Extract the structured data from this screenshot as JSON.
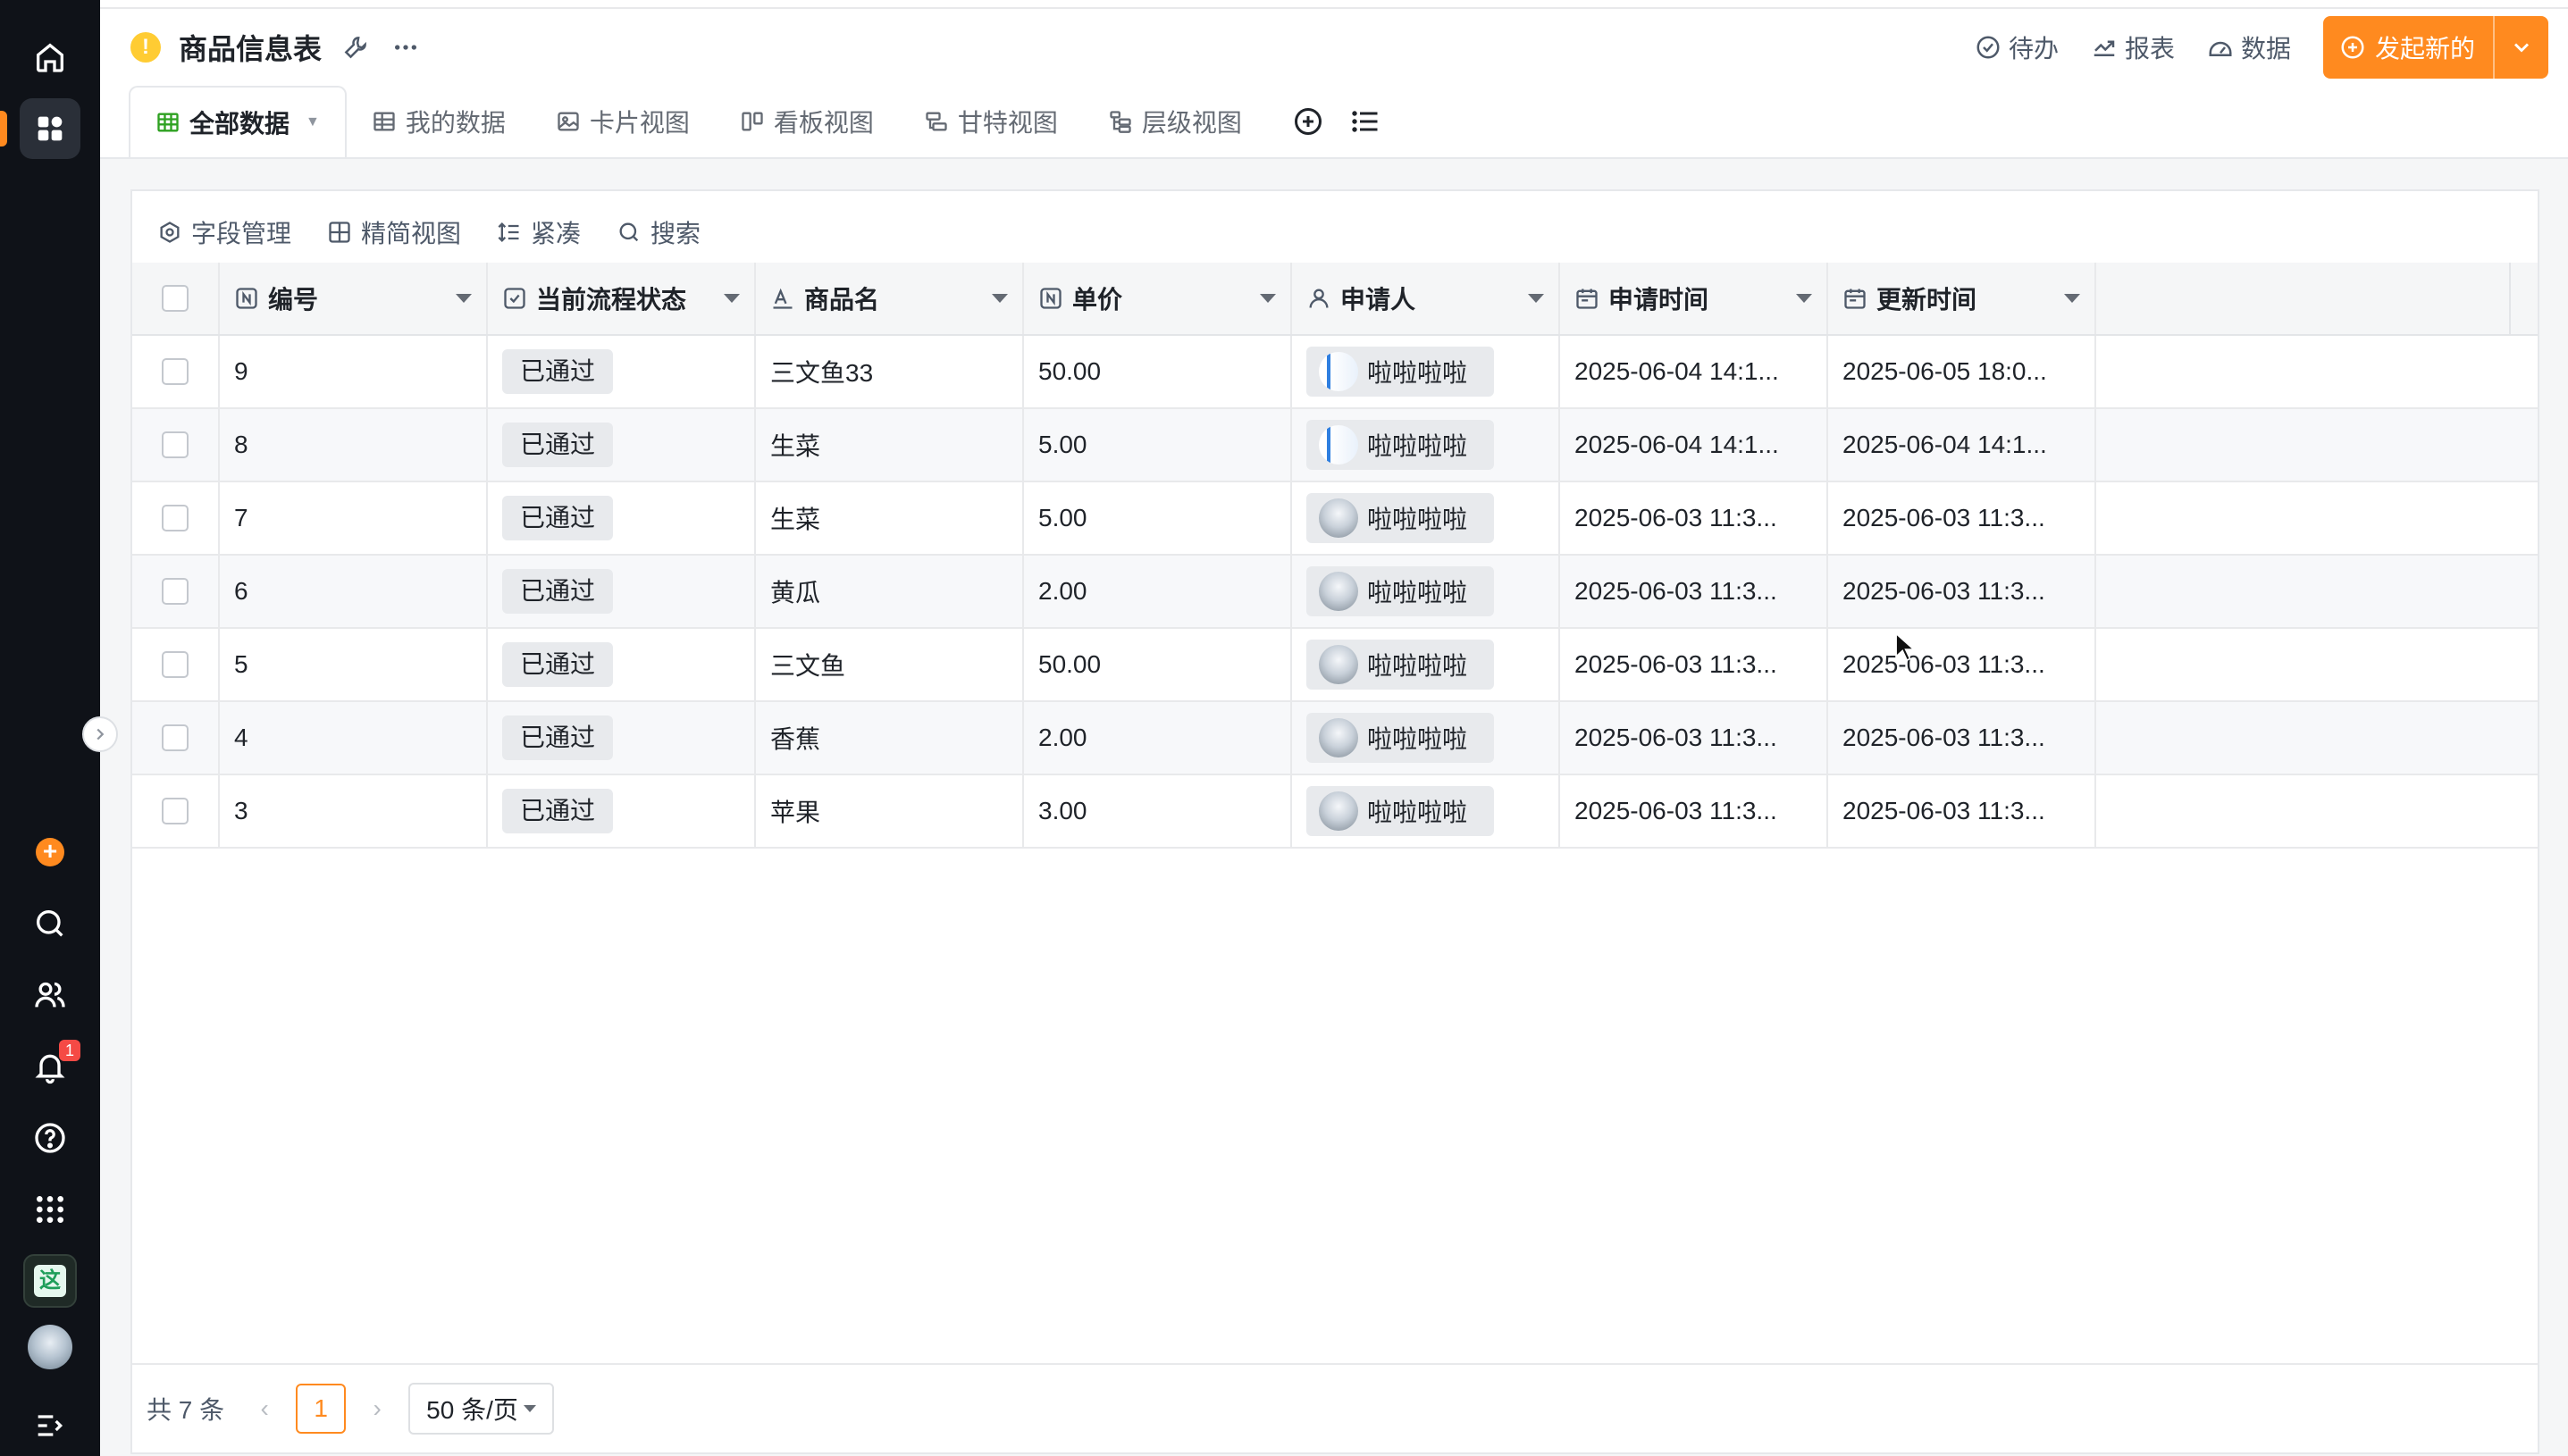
{
  "app": {
    "title": "商品信息表",
    "warn_symbol": "!"
  },
  "rail": {
    "notification_count": "1",
    "app_glyph": "这",
    "add_glyph": "+"
  },
  "top_actions": {
    "todo": "待办",
    "report": "报表",
    "data": "数据",
    "primary": "发起新的"
  },
  "tabs": [
    {
      "label": "全部数据"
    },
    {
      "label": "我的数据"
    },
    {
      "label": "卡片视图"
    },
    {
      "label": "看板视图"
    },
    {
      "label": "甘特视图"
    },
    {
      "label": "层级视图"
    }
  ],
  "toolbar": {
    "fields": "字段管理",
    "compact_view": "精简视图",
    "density": "紧凑",
    "search": "搜索"
  },
  "table": {
    "columns": [
      "编号",
      "当前流程状态",
      "商品名",
      "单价",
      "申请人",
      "申请时间",
      "更新时间"
    ],
    "rows": [
      {
        "id": "9",
        "status": "已通过",
        "name": "三文鱼33",
        "price": "50.00",
        "applicant": "啦啦啦啦",
        "applied": "2025-06-04 14:1...",
        "updated": "2025-06-05 18:0..."
      },
      {
        "id": "8",
        "status": "已通过",
        "name": "生菜",
        "price": "5.00",
        "applicant": "啦啦啦啦",
        "applied": "2025-06-04 14:1...",
        "updated": "2025-06-04 14:1..."
      },
      {
        "id": "7",
        "status": "已通过",
        "name": "生菜",
        "price": "5.00",
        "applicant": "啦啦啦啦",
        "applied": "2025-06-03 11:3...",
        "updated": "2025-06-03 11:3..."
      },
      {
        "id": "6",
        "status": "已通过",
        "name": "黄瓜",
        "price": "2.00",
        "applicant": "啦啦啦啦",
        "applied": "2025-06-03 11:3...",
        "updated": "2025-06-03 11:3..."
      },
      {
        "id": "5",
        "status": "已通过",
        "name": "三文鱼",
        "price": "50.00",
        "applicant": "啦啦啦啦",
        "applied": "2025-06-03 11:3...",
        "updated": "2025-06-03 11:3..."
      },
      {
        "id": "4",
        "status": "已通过",
        "name": "香蕉",
        "price": "2.00",
        "applicant": "啦啦啦啦",
        "applied": "2025-06-03 11:3...",
        "updated": "2025-06-03 11:3..."
      },
      {
        "id": "3",
        "status": "已通过",
        "name": "苹果",
        "price": "3.00",
        "applicant": "啦啦啦啦",
        "applied": "2025-06-03 11:3...",
        "updated": "2025-06-03 11:3..."
      }
    ]
  },
  "pagination": {
    "total": "共 7 条",
    "current_page": "1",
    "page_size": "50 条/页",
    "prev": "‹",
    "next": "›"
  },
  "colors": {
    "accent": "#ff8a1f",
    "rail_bg": "#0f1218",
    "badge": "#f54a45"
  }
}
